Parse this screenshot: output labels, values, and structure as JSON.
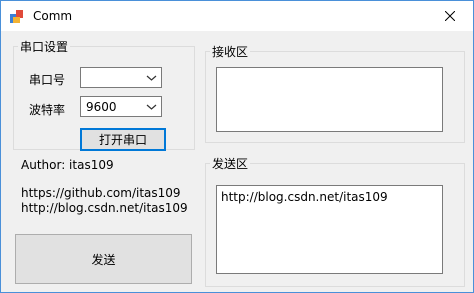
{
  "window": {
    "title": "Comm"
  },
  "serial_group": {
    "legend": "串口设置",
    "port_label": "串口号",
    "port_value": "",
    "baud_label": "波特率",
    "baud_value": "9600",
    "open_button": "打开串口"
  },
  "info": {
    "author": "Author: itas109",
    "link1": "https://github.com/itas109",
    "link2": "http://blog.csdn.net/itas109"
  },
  "receive_group": {
    "legend": "接收区",
    "text": ""
  },
  "send_group": {
    "legend": "发送区",
    "text": "http://blog.csdn.net/itas109"
  },
  "send_button": "发送",
  "colors": {
    "focus_border": "#0078d7",
    "title_border": "#4a90d9",
    "face": "#f0f0f0"
  },
  "icons": [
    "app-icon",
    "close-icon",
    "chevron-down-icon"
  ]
}
